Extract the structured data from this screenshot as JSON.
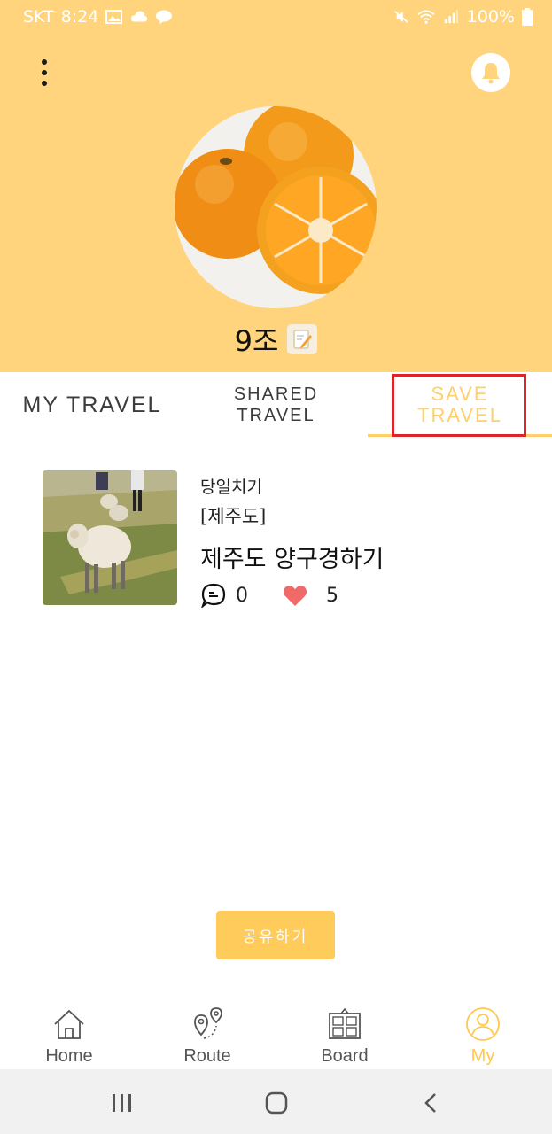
{
  "status_bar": {
    "carrier": "SKT",
    "time": "8:24",
    "battery": "100%",
    "icons": [
      "image-icon",
      "cloud-icon",
      "chat-icon",
      "mute-icon",
      "wifi-icon",
      "signal-icon",
      "battery-icon"
    ]
  },
  "header": {
    "background_color": "#ffd47c",
    "menu_icon": "more-vertical-icon",
    "bell_icon": "bell-icon"
  },
  "profile": {
    "name": "9조",
    "edit_icon": "memo-edit-icon"
  },
  "tabs": [
    {
      "label": "MY TRAVEL",
      "active": false
    },
    {
      "label_line1": "SHARED",
      "label_line2": "TRAVEL",
      "active": false
    },
    {
      "label_line1": "SAVE",
      "label_line2": "TRAVEL",
      "active": true
    }
  ],
  "accent_color": "#ffd06a",
  "highlight_color": "#e0232a",
  "travel_card": {
    "type": "당일치기",
    "region": "[제주도]",
    "title": "제주도 양구경하기",
    "comments": "0",
    "likes": "5",
    "comment_icon": "comment-bubble-icon",
    "like_icon": "heart-icon"
  },
  "share_button": {
    "label": "공유하기"
  },
  "bottom_nav": [
    {
      "label": "Home",
      "icon": "home-icon",
      "active": false
    },
    {
      "label": "Route",
      "icon": "route-pin-icon",
      "active": false
    },
    {
      "label": "Board",
      "icon": "board-icon",
      "active": false
    },
    {
      "label": "My",
      "icon": "user-icon",
      "active": true
    }
  ],
  "system_nav": [
    "recent-apps-icon",
    "home-circle-icon",
    "back-icon"
  ]
}
